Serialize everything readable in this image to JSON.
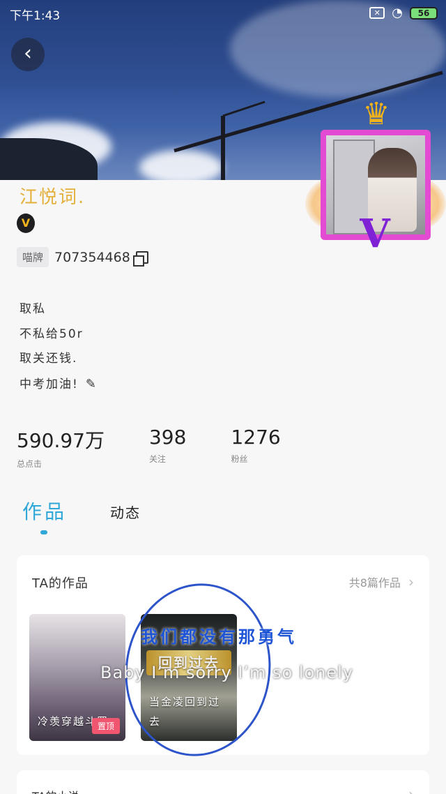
{
  "status_bar": {
    "time": "下午1:43",
    "battery": "56"
  },
  "profile": {
    "nickname": "江悦词.",
    "id_tag": "喵牌",
    "id_number": "707354468",
    "bio_lines": [
      "取私",
      "不私给50r",
      "取关还钱.",
      "中考加油!"
    ]
  },
  "stats": [
    {
      "value": "590.97万",
      "label": "总点击"
    },
    {
      "value": "398",
      "label": "关注"
    },
    {
      "value": "1276",
      "label": "粉丝"
    }
  ],
  "tabs": {
    "works": "作品",
    "news": "动态"
  },
  "works_card": {
    "title": "TA的作品",
    "more": "共8篇作品",
    "books": [
      {
        "title": "冷羡穿越斗罗",
        "tag": "置顶"
      },
      {
        "title": "当金凌回到过去",
        "cover_text": "回到过去"
      }
    ]
  },
  "overlay": {
    "lyric_cn": "我们都没有那勇气",
    "lyric_en": "Baby I’m sorry I’m so lonely"
  },
  "next_card": {
    "title": "TA的小说"
  },
  "colors": {
    "accent": "#2fa8d8",
    "nickname": "#e4b03c",
    "frame": "#e24bd2",
    "tag": "#f0566f"
  }
}
